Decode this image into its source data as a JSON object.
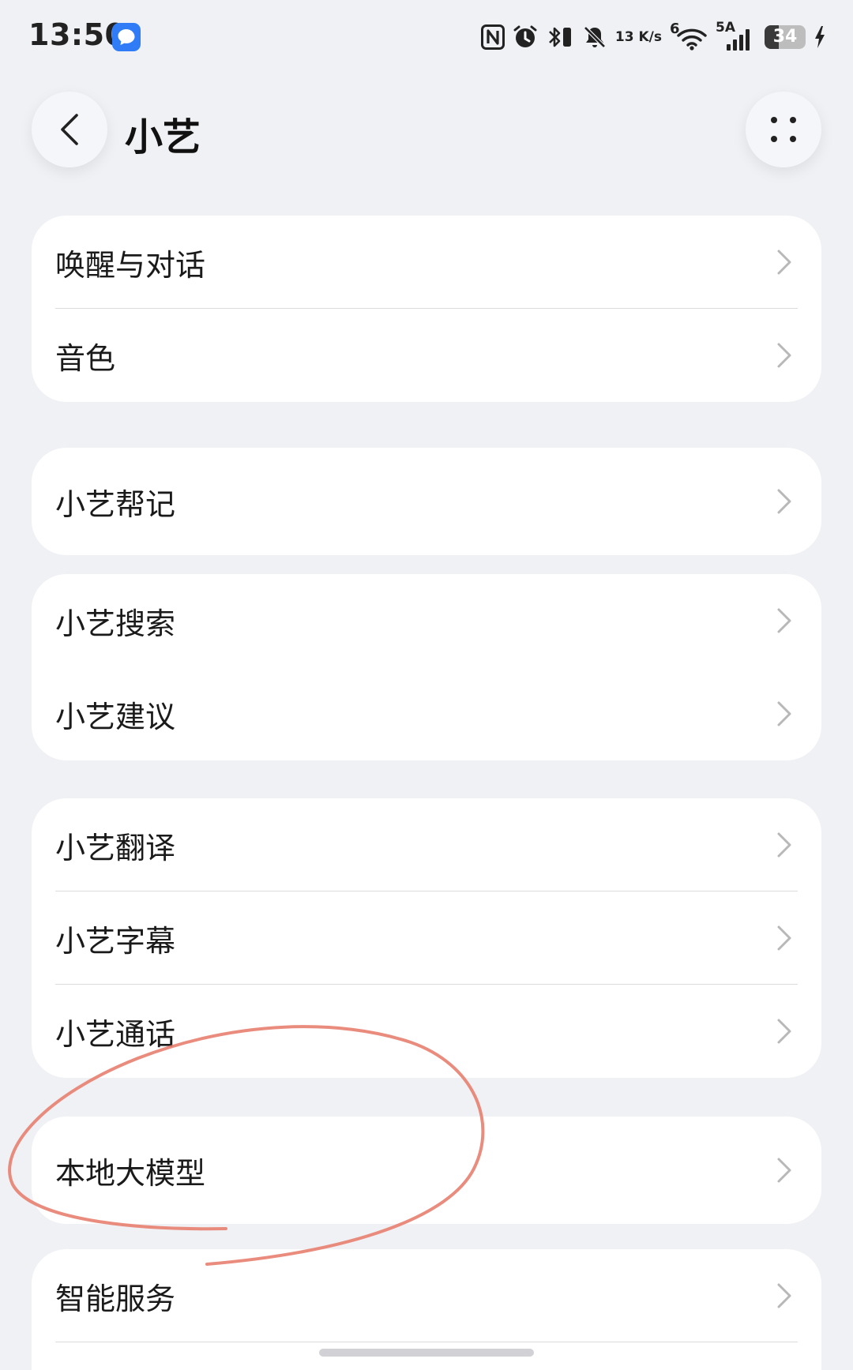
{
  "status_bar": {
    "time": "13:50",
    "net_speed_value": "13",
    "net_speed_unit": "K/s",
    "wifi_label": "6",
    "cell_label": "5A",
    "battery_level": "34",
    "icons": [
      "message-icon",
      "nfc-icon",
      "alarm-icon",
      "bluetooth-icon",
      "mute-icon",
      "wifi-icon",
      "signal-icon",
      "battery-icon",
      "charging-icon"
    ]
  },
  "header": {
    "title": "小艺",
    "back_icon": "chevron-left-icon",
    "more_icon": "more-dots-icon"
  },
  "groups": [
    {
      "items": [
        {
          "label": "唤醒与对话"
        },
        {
          "label": "音色"
        }
      ]
    },
    {
      "items": [
        {
          "label": "小艺帮记"
        }
      ]
    },
    {
      "items": [
        {
          "label": "小艺搜索"
        },
        {
          "label": "小艺建议"
        }
      ]
    },
    {
      "items": [
        {
          "label": "小艺翻译"
        },
        {
          "label": "小艺字幕"
        },
        {
          "label": "小艺通话"
        }
      ]
    },
    {
      "items": [
        {
          "label": "本地大模型"
        }
      ]
    },
    {
      "items": [
        {
          "label": "智能服务"
        }
      ]
    }
  ],
  "annotation": {
    "color": "#e8806f",
    "target": "本地大模型"
  },
  "colors": {
    "background": "#f0f1f5",
    "card": "#ffffff",
    "accent_message": "#2f7cf6"
  }
}
